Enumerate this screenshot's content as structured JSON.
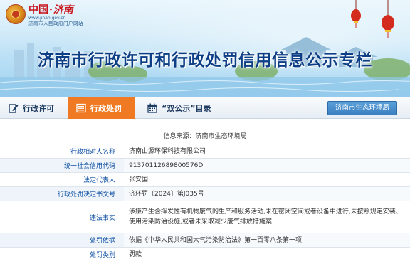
{
  "header": {
    "logo_main": "中国",
    "logo_sep": "·",
    "logo_city": "济南",
    "logo_url": "www.jinan.gov.cn",
    "logo_sub": "济南市人民政府门户网站",
    "title": "济南市行政许可和行政处罚信用信息公示专栏"
  },
  "nav": {
    "tabs": [
      {
        "label": "行政许可",
        "icon": "edit-icon",
        "active": false
      },
      {
        "label": "行政处罚",
        "icon": "list-icon",
        "active": true
      },
      {
        "label": "“双公示”目录",
        "icon": "calendar-icon",
        "active": false
      }
    ],
    "dept_button": "济南市生态环境局",
    "active_color": "#f07a23"
  },
  "record": {
    "source_label": "信息来源：",
    "source_value": "济南市生态环境局",
    "fields": [
      {
        "label": "行政相对人名称",
        "value": "济南山源环保科技有限公司"
      },
      {
        "label": "统一社会信用代码",
        "value": "91370112689800576D"
      },
      {
        "label": "法定代表人",
        "value": "张安国"
      },
      {
        "label": "行政处罚决定书文号",
        "value": "济环罚〔2024〕第J035号"
      },
      {
        "label": "违法事实",
        "value": "涉嫌产生含挥发性有机物废气的生产和服务活动,未在密闭空间或者设备中进行,未按照规定安装、使用污染防治设施,或者未采取减少废气排放措施案"
      },
      {
        "label": "处罚依据",
        "value": "依据《中华人民共和国大气污染防治法》第一百零八条第一项"
      },
      {
        "label": "处罚类别",
        "value": "罚款"
      }
    ]
  }
}
